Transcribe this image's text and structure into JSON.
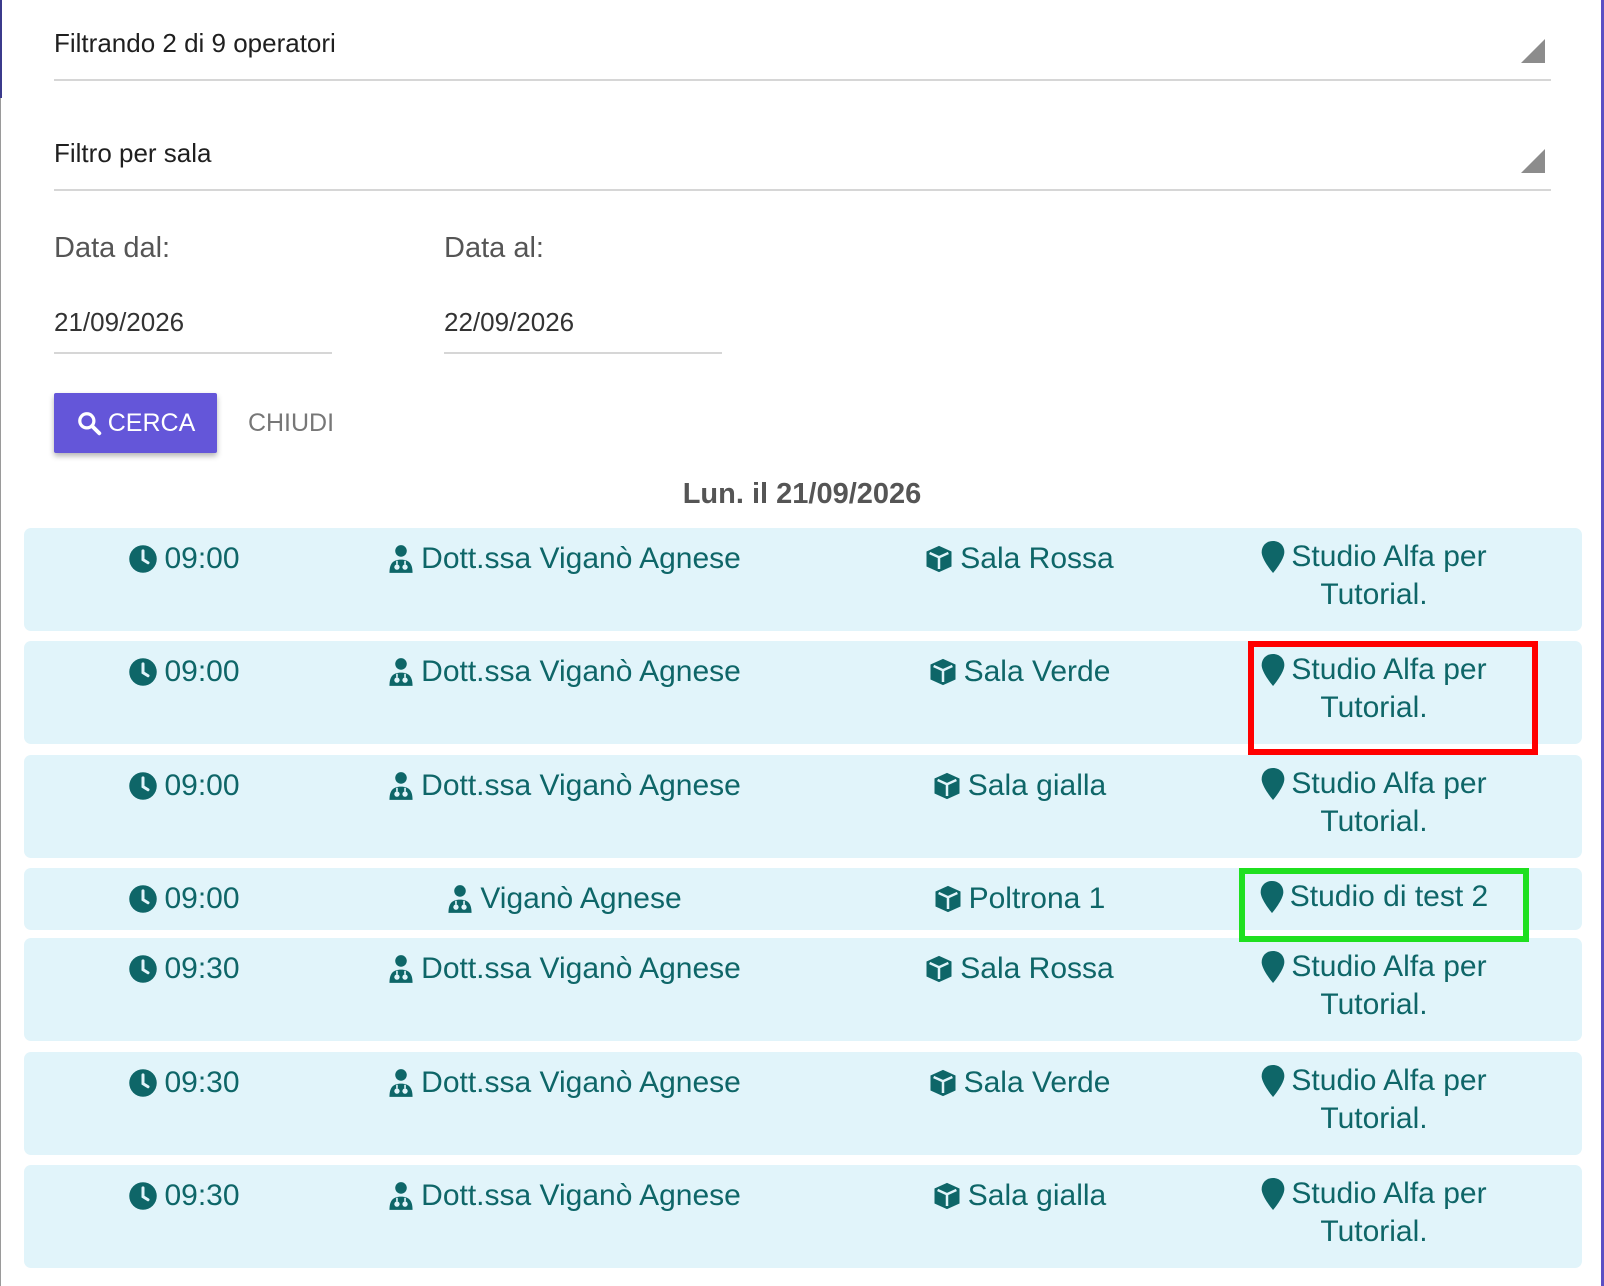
{
  "filters": {
    "operatori_label": "Filtrando 2 di 9 operatori",
    "sala_label": "Filtro per sala",
    "date_from_label": "Data dal:",
    "date_from_value": "21/09/2026",
    "date_to_label": "Data al:",
    "date_to_value": "22/09/2026"
  },
  "actions": {
    "search_label": "CERCA",
    "close_label": "CHIUDI"
  },
  "day_heading": "Lun. il 21/09/2026",
  "rows": [
    {
      "time": "09:00",
      "operator": "Dott.ssa Viganò Agnese",
      "room": "Sala Rossa",
      "place_l1": "Studio Alfa per",
      "place_l2": "Tutorial."
    },
    {
      "time": "09:00",
      "operator": "Dott.ssa Viganò Agnese",
      "room": "Sala Verde",
      "place_l1": "Studio Alfa per",
      "place_l2": "Tutorial."
    },
    {
      "time": "09:00",
      "operator": "Dott.ssa Viganò Agnese",
      "room": "Sala gialla",
      "place_l1": "Studio Alfa per",
      "place_l2": "Tutorial."
    },
    {
      "time": "09:00",
      "operator": "Viganò Agnese",
      "room": "Poltrona 1",
      "place_l1": "Studio di test 2",
      "place_l2": ""
    },
    {
      "time": "09:30",
      "operator": "Dott.ssa Viganò Agnese",
      "room": "Sala Rossa",
      "place_l1": "Studio Alfa per",
      "place_l2": "Tutorial."
    },
    {
      "time": "09:30",
      "operator": "Dott.ssa Viganò Agnese",
      "room": "Sala Verde",
      "place_l1": "Studio Alfa per",
      "place_l2": "Tutorial."
    },
    {
      "time": "09:30",
      "operator": "Dott.ssa Viganò Agnese",
      "room": "Sala gialla",
      "place_l1": "Studio Alfa per",
      "place_l2": "Tutorial."
    }
  ],
  "icons": {
    "time": "clock-icon",
    "operator": "user-md-icon",
    "room": "cube-icon",
    "place": "map-marker-icon",
    "search": "search-icon"
  },
  "colors": {
    "accent": "#6456d9",
    "row_background": "#e1f4fa",
    "row_text": "#0e6668",
    "highlight_red": "#ff0000",
    "highlight_green": "#1fe01f"
  }
}
